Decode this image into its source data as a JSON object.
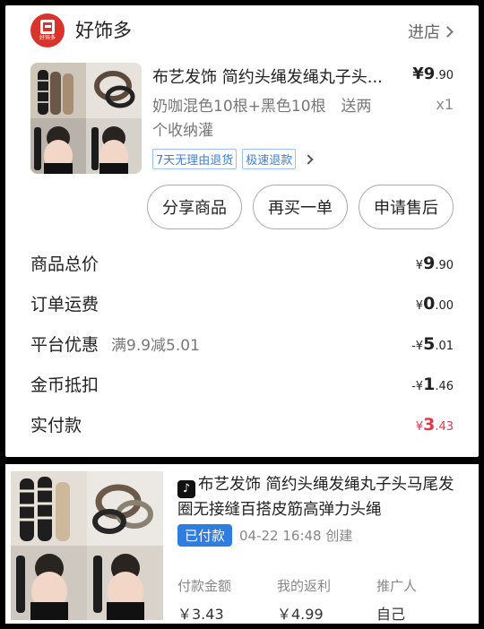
{
  "shop": {
    "name": "好饰多",
    "logo_text": "好饰多",
    "enter_label": "进店"
  },
  "product": {
    "title": "布艺发饰 简约头绳发绳丸子头...",
    "price_symbol": "¥",
    "price_int": "9",
    "price_dec": ".90",
    "spec": "奶咖混色10根+黑色10根　送两个收纳灌",
    "quantity": "x1",
    "tags": [
      "7天无理由退货",
      "极速退款"
    ]
  },
  "actions": {
    "share": "分享商品",
    "rebuy": "再买一单",
    "after_sale": "申请售后"
  },
  "summary": {
    "total": {
      "label": "商品总价",
      "sym": "¥",
      "int": "9",
      "dec": ".90"
    },
    "shipping": {
      "label": "订单运费",
      "sym": "¥",
      "int": "0",
      "dec": ".00"
    },
    "discount": {
      "label": "平台优惠",
      "note": "满9.9减5.01",
      "sym": "-¥",
      "int": "5",
      "dec": ".01"
    },
    "coins": {
      "label": "金币抵扣",
      "sym": "-¥",
      "int": "1",
      "dec": ".46"
    },
    "paid": {
      "label": "实付款",
      "sym": "¥",
      "int": "3",
      "dec": ".43"
    }
  },
  "order_card": {
    "platform_icon": "tiktok-icon",
    "title": "布艺发饰 简约头绳发绳丸子头马尾发圈无接缝百搭皮筋高弹力头绳",
    "status": "已付款",
    "created": "04-22 16:48 创建",
    "metrics": [
      {
        "label": "付款金额",
        "value": "￥3.43"
      },
      {
        "label": "我的返利",
        "value": "￥4.99"
      },
      {
        "label": "推广人",
        "value": "自己"
      }
    ]
  },
  "colors": {
    "brand_red": "#d9332b",
    "paid_red": "#e0394c",
    "tag_blue": "#3b7fd8",
    "status_blue": "#2f7de1"
  }
}
